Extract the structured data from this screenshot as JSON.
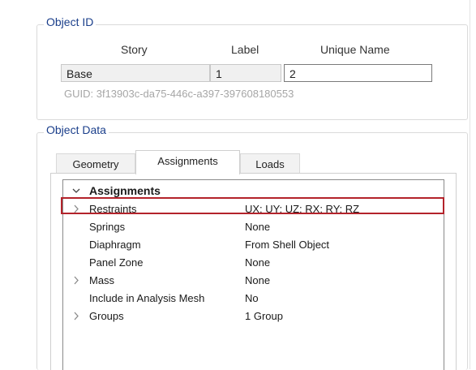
{
  "object_id": {
    "legend": "Object ID",
    "headers": {
      "story": "Story",
      "label": "Label",
      "unique_name": "Unique Name"
    },
    "values": {
      "story": "Base",
      "label": "1",
      "unique_name": "2"
    },
    "guid": "GUID:  3f13903c-da75-446c-a397-397608180553"
  },
  "object_data": {
    "legend": "Object Data",
    "tabs": [
      {
        "label": "Geometry",
        "active": false
      },
      {
        "label": "Assignments",
        "active": true
      },
      {
        "label": "Loads",
        "active": false
      }
    ],
    "grid": {
      "category": {
        "label": "Assignments",
        "expanded": true
      },
      "rows": [
        {
          "name": "Restraints",
          "value": "UX; UY; UZ; RX; RY; RZ",
          "expandable": true,
          "highlighted": true
        },
        {
          "name": "Springs",
          "value": "None",
          "expandable": false
        },
        {
          "name": "Diaphragm",
          "value": "From Shell Object",
          "expandable": false
        },
        {
          "name": "Panel Zone",
          "value": "None",
          "expandable": false
        },
        {
          "name": "Mass",
          "value": "None",
          "expandable": true
        },
        {
          "name": "Include in Analysis Mesh",
          "value": "No",
          "expandable": false
        },
        {
          "name": "Groups",
          "value": "1 Group",
          "expandable": true
        }
      ]
    }
  },
  "colors": {
    "legend_text": "#1b3f8b",
    "highlight_border": "#b3232b",
    "readonly_field_bg": "#f0f0f0",
    "guid_text": "#a6a6a6"
  },
  "icons": {
    "category_expander": "chevron-down-icon",
    "row_expander": "chevron-right-icon"
  }
}
